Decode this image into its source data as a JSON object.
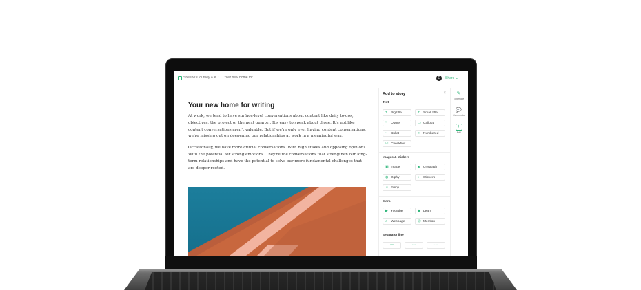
{
  "topbar": {
    "breadcrumb_1": "Sheebe's journey & e...",
    "breadcrumb_sep": "/",
    "breadcrumb_2": "Your new home for...",
    "avatar_initial": "E",
    "share_label": "Share ⌄"
  },
  "document": {
    "title": "Your new home for writing",
    "paragraphs": [
      "At work, we tend to have surface-level conversations about content like daily to-dos, objectives, the project or the next quarter. It's easy to speak about those. It's not like content conversations aren't valuable. But if we're only ever having content conversations, we're missing out on deepening our relationships at work in a meaningful way.",
      "Occasionally, we have more crucial conversations. With high stakes and opposing opinions. With the potential for strong emotions. They're the conversations that strengthen our long-term relationships and have the potential to solve our more fundamental challenges that are deeper rooted."
    ]
  },
  "panel": {
    "title": "Add to story",
    "close": "×",
    "sections": {
      "text": "Text",
      "images": "Images & stickers",
      "extra": "Extra",
      "separator": "Separator line"
    },
    "text_items": [
      {
        "icon": "T",
        "label": "Big title"
      },
      {
        "icon": "T",
        "label": "Small title"
      },
      {
        "icon": "❝",
        "label": "Quote"
      },
      {
        "icon": "▭",
        "label": "Callout"
      },
      {
        "icon": "•",
        "label": "Bullet"
      },
      {
        "icon": "≡",
        "label": "Numbered"
      },
      {
        "icon": "☑",
        "label": "Checkbox"
      }
    ],
    "image_items": [
      {
        "icon": "▣",
        "label": "Image"
      },
      {
        "icon": "◙",
        "label": "Unsplash"
      },
      {
        "icon": "◍",
        "label": "Giphy"
      },
      {
        "icon": "◐",
        "label": "Stickers"
      },
      {
        "icon": "☺",
        "label": "Emoji"
      }
    ],
    "extra_items": [
      {
        "icon": "▶",
        "label": "Youtube"
      },
      {
        "icon": "◆",
        "label": "Learn"
      },
      {
        "icon": "⌂",
        "label": "Webpage"
      },
      {
        "icon": "@",
        "label": "Mention"
      }
    ],
    "separators": [
      "—",
      "···",
      "- - -"
    ]
  },
  "rail": {
    "edit": {
      "icon": "✎",
      "label": "Edit mode"
    },
    "comments": {
      "icon": "💬",
      "label": "Comments"
    },
    "add": {
      "icon": "+",
      "label": "Add"
    }
  },
  "colors": {
    "accent": "#2fb67a",
    "hero_blue": "#1c7e9c",
    "hero_orange": "#c8673e",
    "hero_pink": "#f2b4a0"
  }
}
